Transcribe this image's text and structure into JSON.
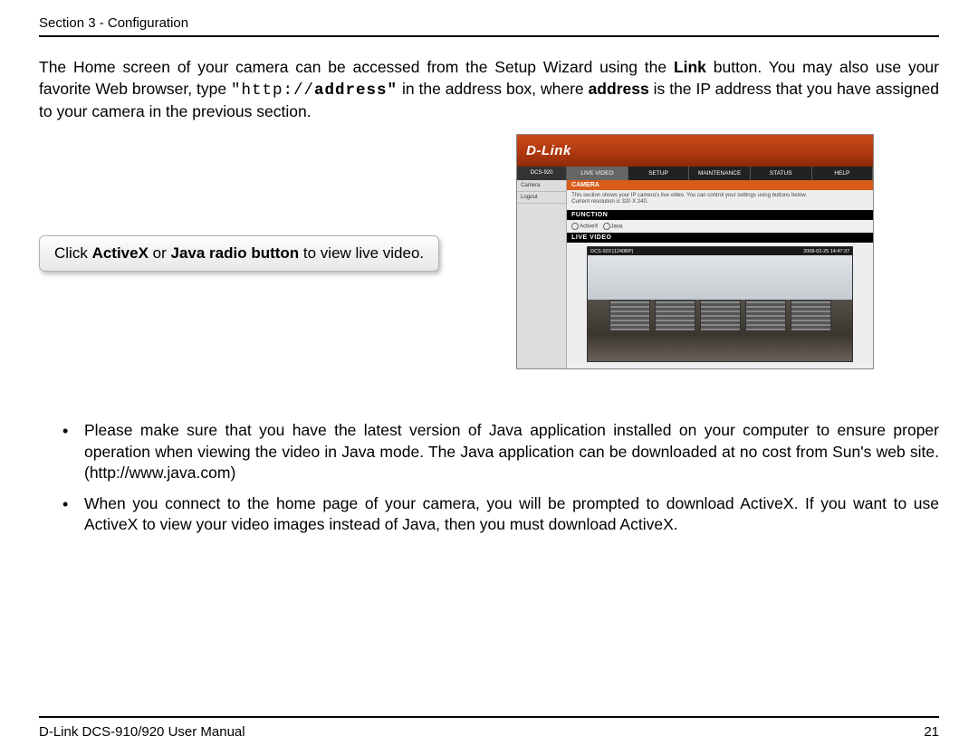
{
  "header": {
    "section": "Section 3 - Configuration"
  },
  "intro": {
    "pre": "The Home screen of your camera can be accessed from the Setup Wizard using the ",
    "link_word": "Link",
    "mid1": " button. You may also use your favorite Web browser, type ",
    "http_prefix": "\"http://",
    "addr_word": "address\"",
    "mid2": " in the address box, where ",
    "addr_bold": "address",
    "tail": " is the IP address that you have assigned to your camera in the previous section."
  },
  "callout": {
    "pre": "Click ",
    "b1": "ActiveX",
    "mid": " or ",
    "b2": "Java radio button",
    "post": " to view live video."
  },
  "screenshot": {
    "brand": "D-Link",
    "model": "DCS-920",
    "tabs": [
      "LIVE VIDEO",
      "SETUP",
      "MAINTENANCE",
      "STATUS",
      "HELP"
    ],
    "side": [
      "Camera",
      "Logout"
    ],
    "camera_title": "CAMERA",
    "desc1": "This section shows your IP camera's live video. You can control your settings using buttons below.",
    "desc2": "Current resolution is 320 X 240.",
    "function_title": "FUNCTION",
    "radio1": "ActiveX",
    "radio2": "Java",
    "live_title": "LIVE VIDEO",
    "overlay_left": "DCS-920  [1240BP]",
    "overlay_right": "2008-02-25 14:47:37"
  },
  "bullets": {
    "b1": "Please make sure that you have the latest version of Java application installed on your computer to ensure proper operation when viewing the video in Java mode. The Java application can be downloaded at no cost from Sun's web site. (http://www.java.com)",
    "b2": "When you connect to the home page of your camera, you will be prompted to download ActiveX. If you want to use ActiveX to view your video images instead of Java, then you must download ActiveX."
  },
  "footer": {
    "left": "D-Link DCS-910/920 User Manual",
    "right": "21"
  }
}
